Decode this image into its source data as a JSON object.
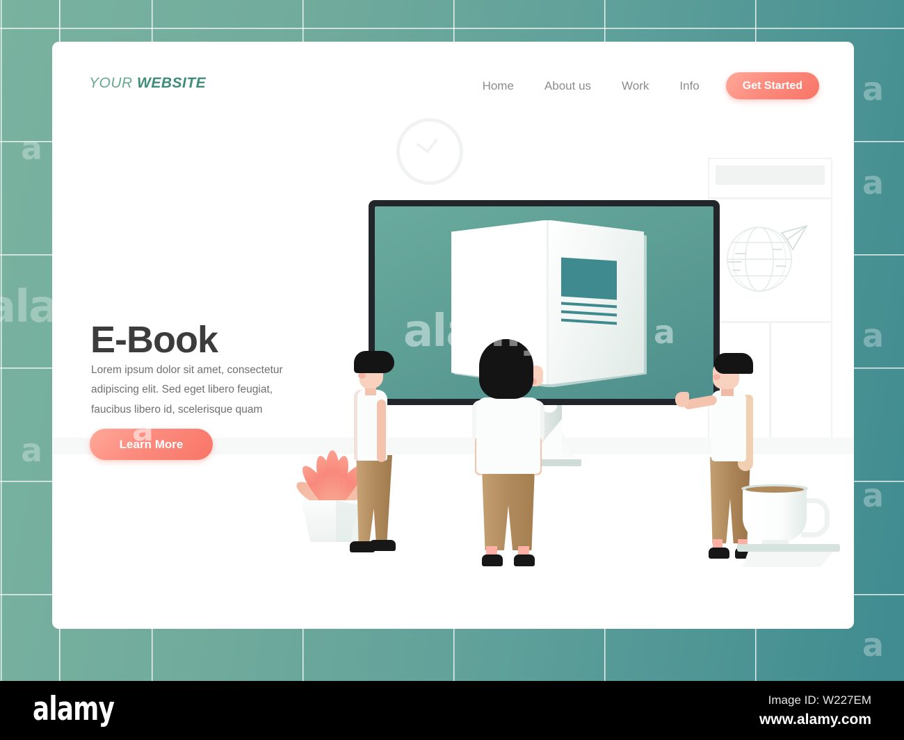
{
  "brand": {
    "logo_part1": "YOUR ",
    "logo_part2": "WEBSITE",
    "accent_color": "#f8897c",
    "teal_color": "#5fa096"
  },
  "nav": {
    "items": [
      {
        "label": "Home"
      },
      {
        "label": "About us"
      },
      {
        "label": "Work"
      },
      {
        "label": "Info"
      }
    ],
    "cta_label": "Get Started"
  },
  "hero": {
    "headline": "E-Book",
    "body": "Lorem ipsum dolor sit amet, consectetur adipiscing elit. Sed eget libero feugiat, faucibus libero id, scelerisque quam",
    "cta_label": "Learn More"
  },
  "illustration": {
    "monitor_label": "desktop-monitor",
    "screen_content": "open-book",
    "people_count": 3,
    "props": [
      "potted-plant",
      "coffee-cup",
      "wall-clock",
      "globe-paper-plane-poster"
    ]
  },
  "watermark": {
    "letter": "a",
    "brand": "alamy",
    "image_id": "Image ID: W227EM",
    "url": "www.alamy.com"
  }
}
